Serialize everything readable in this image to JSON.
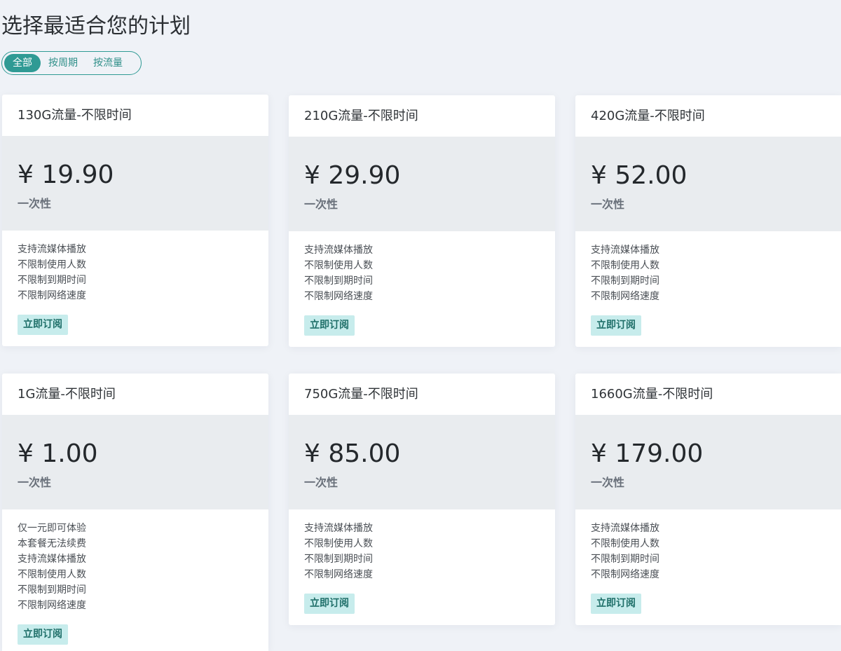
{
  "page_title": "选择最适合您的计划",
  "filters": [
    {
      "label": "全部",
      "active": true
    },
    {
      "label": "按周期",
      "active": false
    },
    {
      "label": "按流量",
      "active": false
    }
  ],
  "plans": [
    {
      "name": "130G流量-不限时间",
      "price": "¥ 19.90",
      "period": "一次性",
      "features": [
        "支持流媒体播放",
        "不限制使用人数",
        "不限制到期时间",
        "不限制网络速度"
      ],
      "button": "立即订阅"
    },
    {
      "name": "210G流量-不限时间",
      "price": "¥ 29.90",
      "period": "一次性",
      "features": [
        "支持流媒体播放",
        "不限制使用人数",
        "不限制到期时间",
        "不限制网络速度"
      ],
      "button": "立即订阅"
    },
    {
      "name": "420G流量-不限时间",
      "price": "¥ 52.00",
      "period": "一次性",
      "features": [
        "支持流媒体播放",
        "不限制使用人数",
        "不限制到期时间",
        "不限制网络速度"
      ],
      "button": "立即订阅"
    },
    {
      "name": "1G流量-不限时间",
      "price": "¥ 1.00",
      "period": "一次性",
      "features": [
        "仅一元即可体验",
        "本套餐无法续费",
        "支持流媒体播放",
        "不限制使用人数",
        "不限制到期时间",
        "不限制网络速度"
      ],
      "button": "立即订阅"
    },
    {
      "name": "750G流量-不限时间",
      "price": "¥ 85.00",
      "period": "一次性",
      "features": [
        "支持流媒体播放",
        "不限制使用人数",
        "不限制到期时间",
        "不限制网络速度"
      ],
      "button": "立即订阅"
    },
    {
      "name": "1660G流量-不限时间",
      "price": "¥ 179.00",
      "period": "一次性",
      "features": [
        "支持流媒体播放",
        "不限制使用人数",
        "不限制到期时间",
        "不限制网络速度"
      ],
      "button": "立即订阅"
    }
  ]
}
